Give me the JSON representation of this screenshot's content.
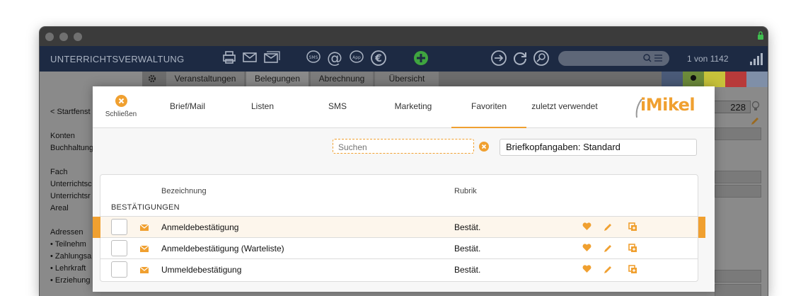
{
  "app": {
    "title": "UNTERRICHTSVERWALTUNG",
    "record_counter": "1 von 1142",
    "sub_tabs": [
      "Veranstaltungen",
      "Belegungen",
      "Abrechnung",
      "Übersicht"
    ],
    "side_field_value": "228",
    "color_blocks": [
      "#4a5a78",
      "#6c8a3a",
      "#c7c23a",
      "#b83a3a",
      "#7f8fa8"
    ]
  },
  "left_nav": {
    "back": "< Startfenst",
    "items": [
      "Konten",
      "Buchhaltung",
      "Fach",
      "Unterrichtsc",
      "Unterrichtsr",
      "Areal",
      "Adressen",
      "• Teilnehm",
      "• Zahlungsa",
      "• Lehrkraft",
      "• Erziehung"
    ]
  },
  "modal": {
    "close_label": "Schließen",
    "tabs": [
      {
        "label": "Brief/Mail",
        "active": false
      },
      {
        "label": "Listen",
        "active": false
      },
      {
        "label": "SMS",
        "active": false
      },
      {
        "label": "Marketing",
        "active": false
      },
      {
        "label": "Favoriten",
        "active": true
      },
      {
        "label": "zuletzt verwendet",
        "active": false
      }
    ],
    "logo": "iMikel",
    "search_placeholder": "Suchen",
    "letterhead": "Briefkopfangaben: Standard",
    "table": {
      "col_name": "Bezeichnung",
      "col_rubrik": "Rubrik",
      "group": "BESTÄTIGUNGEN",
      "rows": [
        {
          "name": "Anmeldebestätigung",
          "rubrik": "Bestät.",
          "highlighted": true
        },
        {
          "name": "Anmeldebestätigung (Warteliste)",
          "rubrik": "Bestät.",
          "highlighted": false
        },
        {
          "name": "Ummeldebestätigung",
          "rubrik": "Bestät.",
          "highlighted": false
        }
      ]
    },
    "accent_color": "#f0a030"
  }
}
